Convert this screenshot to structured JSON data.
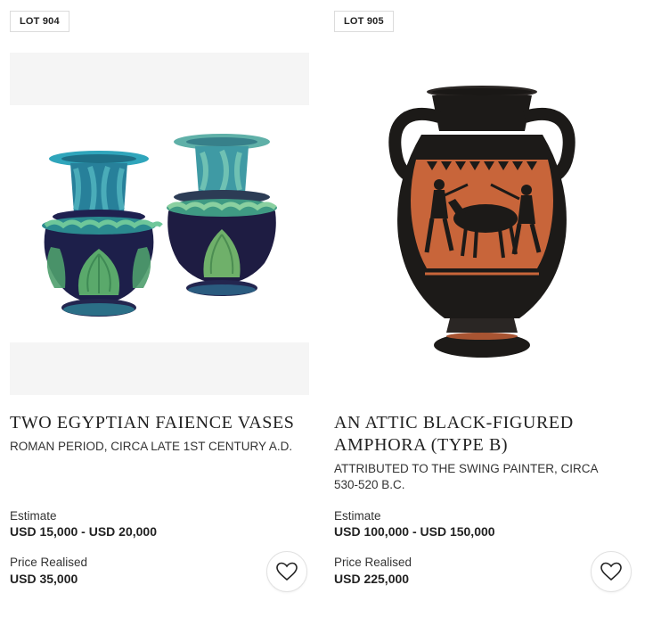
{
  "lots": [
    {
      "lot_label": "LOT 904",
      "title": "TWO EGYPTIAN FAIENCE VASES",
      "subtitle": "ROMAN PERIOD, CIRCA LATE 1ST CENTURY A.D.",
      "estimate_label": "Estimate",
      "estimate_value": "USD 15,000 - USD 20,000",
      "price_label": "Price Realised",
      "price_value": "USD 35,000",
      "favorite_icon": "heart-icon"
    },
    {
      "lot_label": "LOT 905",
      "title_line1": "AN ATTIC BLACK-FIGURED",
      "title_line2": "AMPHORA (TYPE B)",
      "subtitle_line1": "ATTRIBUTED TO THE SWING PAINTER, CIRCA",
      "subtitle_line2": "530-520 B.C.",
      "estimate_label": "Estimate",
      "estimate_value": "USD 100,000 - USD 150,000",
      "price_label": "Price Realised",
      "price_value": "USD 225,000",
      "favorite_icon": "heart-icon"
    }
  ],
  "colors": {
    "faience_blue": "#2a9fb5",
    "faience_green": "#5fae6e",
    "faience_dark": "#1d1f4a",
    "amphora_black": "#1c1a18",
    "amphora_terracotta": "#c8653a"
  }
}
